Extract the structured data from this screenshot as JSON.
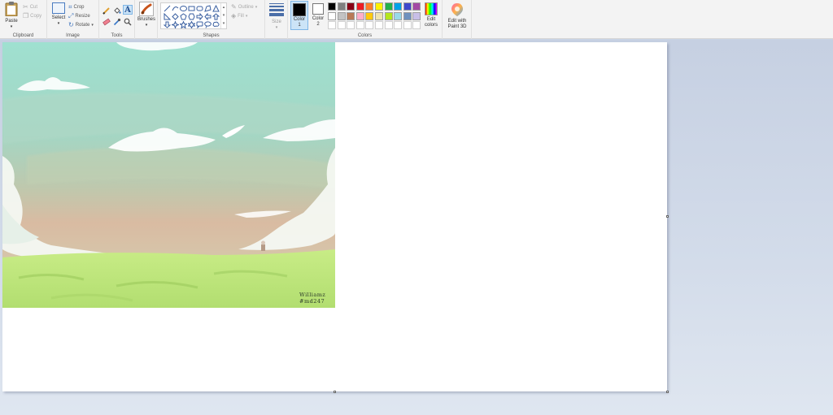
{
  "clipboard": {
    "paste_label": "Paste",
    "cut_label": "Cut",
    "copy_label": "Copy",
    "group_label": "Clipboard"
  },
  "image": {
    "select_label": "Select",
    "crop_label": "Crop",
    "resize_label": "Resize",
    "rotate_label": "Rotate",
    "group_label": "Image"
  },
  "tools": {
    "group_label": "Tools",
    "items": [
      "pencil-icon",
      "fill-icon",
      "text-icon",
      "eraser-icon",
      "color-picker-icon",
      "magnifier-icon"
    ]
  },
  "brushes": {
    "label": "Brushes"
  },
  "shapes": {
    "group_label": "Shapes",
    "outline_label": "Outline",
    "fill_label": "Fill"
  },
  "size": {
    "label": "Size"
  },
  "colors": {
    "color1_label": "Color\n1",
    "color2_label": "Color\n2",
    "color1": "#000000",
    "color2": "#ffffff",
    "edit_colors_label": "Edit\ncolors",
    "group_label": "Colors",
    "palette_row1": [
      "#000000",
      "#7f7f7f",
      "#880015",
      "#ed1c24",
      "#ff7f27",
      "#fff200",
      "#22b14c",
      "#00a2e8",
      "#3f48cc",
      "#a349a4"
    ],
    "palette_row2": [
      "#ffffff",
      "#c3c3c3",
      "#b97a57",
      "#ffaec9",
      "#ffc90e",
      "#efe4b0",
      "#b5e61d",
      "#99d9ea",
      "#7092be",
      "#c8bfe7"
    ],
    "palette_row3": [
      "#ffffff",
      "#ffffff",
      "#ffffff",
      "#ffffff",
      "#ffffff",
      "#ffffff",
      "#ffffff",
      "#ffffff",
      "#ffffff",
      "#ffffff"
    ]
  },
  "paint3d": {
    "label": "Edit with\nPaint 3D"
  },
  "artwork": {
    "signature_line1": "Williamz",
    "signature_line2": "#md247"
  }
}
